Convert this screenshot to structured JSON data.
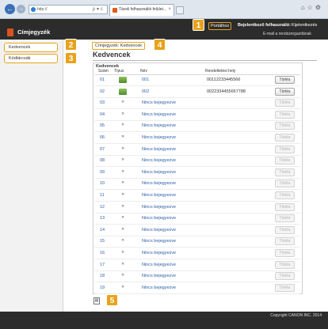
{
  "browser": {
    "back_label": "←",
    "forward_label": "→",
    "address": "http://",
    "address_tools": "ρ▾c",
    "tab_title": "Távoli felhasználói felület...",
    "tab_close": "×",
    "right_icons": "⌂☆⚙"
  },
  "header": {
    "title": "Címjegyzék",
    "portal_label": "Portálhoz",
    "login_user": "Bejelentkező felhasználó:",
    "logout_label": "Kijelentkezés",
    "email_link": "E-mail a rendszergazdának"
  },
  "sidebar": {
    "items": [
      {
        "label": "Kedvencek"
      },
      {
        "label": "Kódtárcsák"
      }
    ]
  },
  "callouts": [
    "1",
    "2",
    "3",
    "4",
    "5"
  ],
  "breadcrumb": "Címjegyzék: Kedvencek",
  "page_title": "Kedvencek",
  "panel": {
    "heading": "Kedvencek",
    "columns": {
      "num": "Szám",
      "type": "Típus",
      "name": "Név",
      "dest": "Rendeltetési hely"
    }
  },
  "rows": [
    {
      "num": "01",
      "type": "stack",
      "name": "001",
      "dest": "00112233445566",
      "delete": "Törlés",
      "enabled": true
    },
    {
      "num": "02",
      "type": "stack",
      "name": "002",
      "dest": "0022334455667788",
      "delete": "Törlés",
      "enabled": true
    },
    {
      "num": "03",
      "type": "dash",
      "name": "Nincs bejegyezve",
      "dest": "",
      "delete": "Törlés",
      "enabled": false
    },
    {
      "num": "04",
      "type": "dash",
      "name": "Nincs bejegyezve",
      "dest": "",
      "delete": "Törlés",
      "enabled": false
    },
    {
      "num": "05",
      "type": "dash",
      "name": "Nincs bejegyezve",
      "dest": "",
      "delete": "Törlés",
      "enabled": false
    },
    {
      "num": "06",
      "type": "dash",
      "name": "Nincs bejegyezve",
      "dest": "",
      "delete": "Törlés",
      "enabled": false
    },
    {
      "num": "07",
      "type": "dash",
      "name": "Nincs bejegyezve",
      "dest": "",
      "delete": "Törlés",
      "enabled": false
    },
    {
      "num": "08",
      "type": "dash",
      "name": "Nincs bejegyezve",
      "dest": "",
      "delete": "Törlés",
      "enabled": false
    },
    {
      "num": "09",
      "type": "dash",
      "name": "Nincs bejegyezve",
      "dest": "",
      "delete": "Törlés",
      "enabled": false
    },
    {
      "num": "10",
      "type": "dash",
      "name": "Nincs bejegyezve",
      "dest": "",
      "delete": "Törlés",
      "enabled": false
    },
    {
      "num": "11",
      "type": "dash",
      "name": "Nincs bejegyezve",
      "dest": "",
      "delete": "Törlés",
      "enabled": false
    },
    {
      "num": "12",
      "type": "dash",
      "name": "Nincs bejegyezve",
      "dest": "",
      "delete": "Törlés",
      "enabled": false
    },
    {
      "num": "13",
      "type": "dash",
      "name": "Nincs bejegyezve",
      "dest": "",
      "delete": "Törlés",
      "enabled": false
    },
    {
      "num": "14",
      "type": "dash",
      "name": "Nincs bejegyezve",
      "dest": "",
      "delete": "Törlés",
      "enabled": false
    },
    {
      "num": "15",
      "type": "dash",
      "name": "Nincs bejegyezve",
      "dest": "",
      "delete": "Törlés",
      "enabled": false
    },
    {
      "num": "16",
      "type": "dash",
      "name": "Nincs bejegyezve",
      "dest": "",
      "delete": "Törlés",
      "enabled": false
    },
    {
      "num": "17",
      "type": "dash",
      "name": "Nincs bejegyezve",
      "dest": "",
      "delete": "Törlés",
      "enabled": false
    },
    {
      "num": "18",
      "type": "dash",
      "name": "Nincs bejegyezve",
      "dest": "",
      "delete": "Törlés",
      "enabled": false
    },
    {
      "num": "19",
      "type": "dash",
      "name": "Nincs bejegyezve",
      "dest": "",
      "delete": "Törlés",
      "enabled": false
    }
  ],
  "type_dash_glyph": "»",
  "page_icon_glyph": "▤",
  "footer": {
    "copyright": "Copyright CANON INC. 2014"
  },
  "colors": {
    "accent": "#e8a21c",
    "link": "#2a5da6",
    "header_bg": "#2c2c2c"
  }
}
